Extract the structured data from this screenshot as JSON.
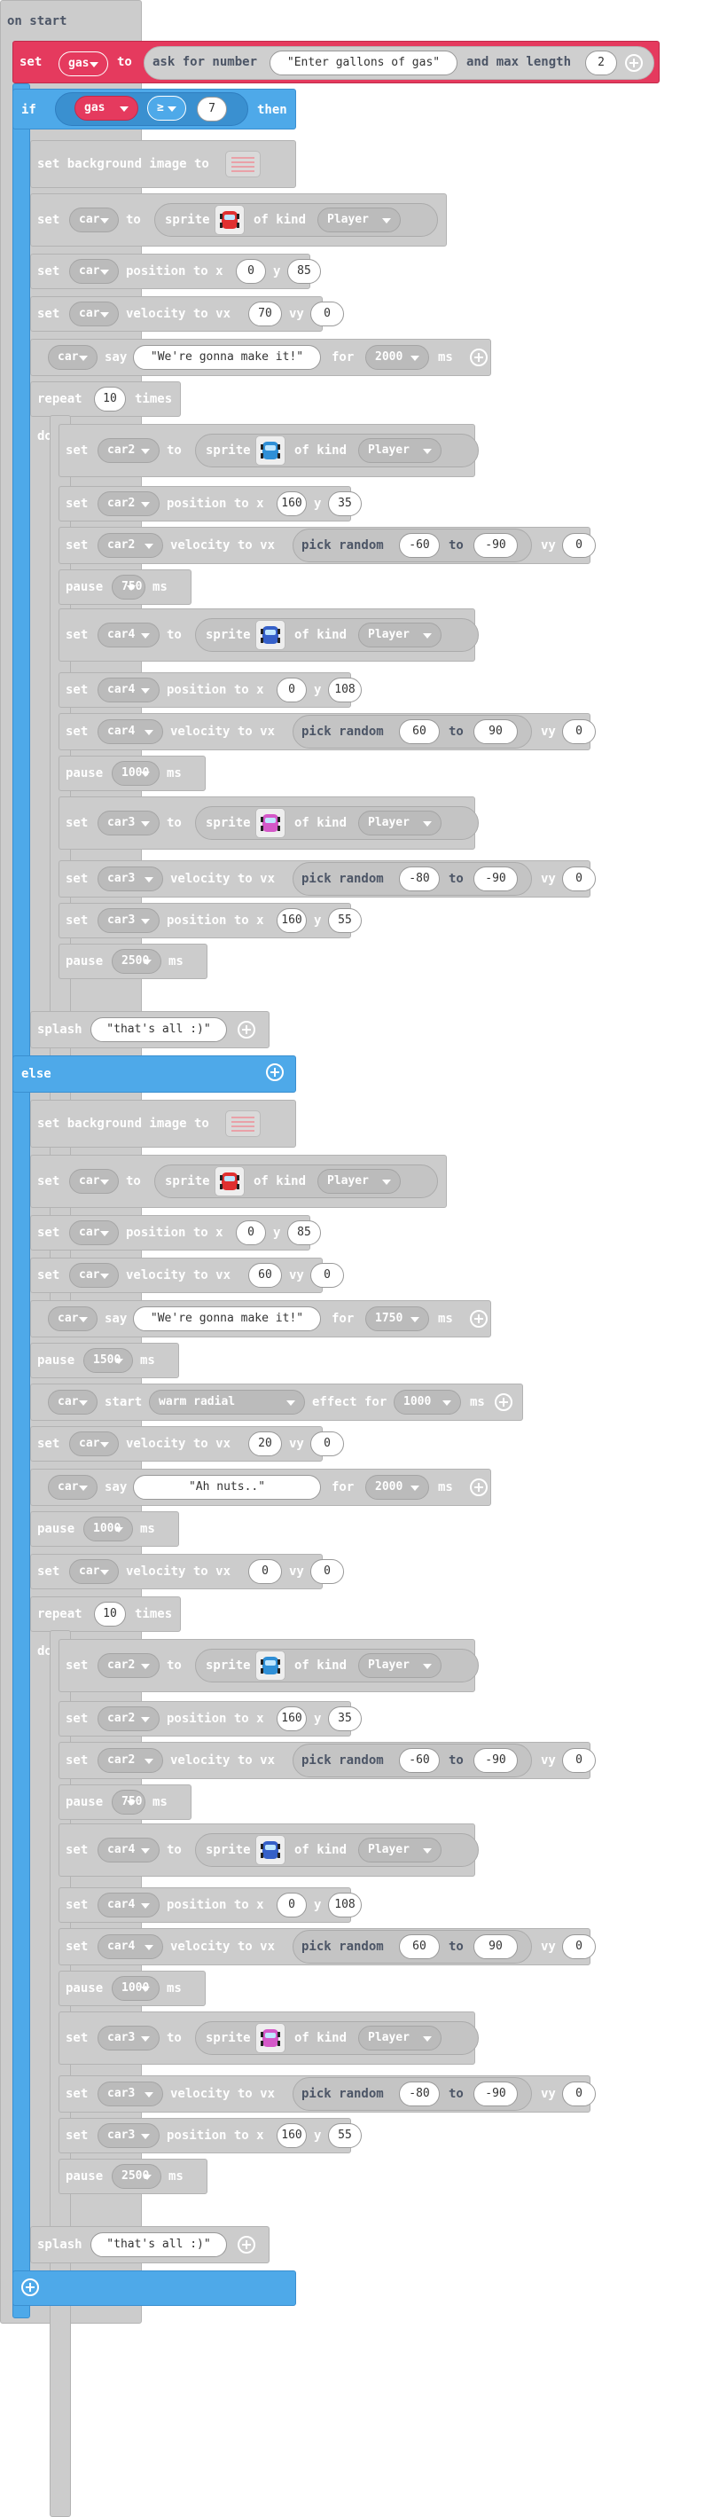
{
  "event": {
    "label": "on start"
  },
  "gas_row": {
    "set": "set",
    "var": "gas",
    "to": "to",
    "ask": "ask for number",
    "prompt": "\"Enter gallons of gas\"",
    "and_max": "and max length",
    "max": "2"
  },
  "if_row": {
    "if": "if",
    "var": "gas",
    "op": "≥",
    "value": "7",
    "then": "then"
  },
  "else_label": "else",
  "rows_if": [
    {
      "t": "bg"
    },
    {
      "t": "sprite",
      "v": "car",
      "k": "Player",
      "c": "red"
    },
    {
      "t": "pos",
      "v": "car",
      "x": "0",
      "y": "85"
    },
    {
      "t": "vel",
      "v": "car",
      "vx": "70",
      "vy": "0"
    },
    {
      "t": "say",
      "v": "car",
      "text": "\"We're gonna make it!\"",
      "ms": "2000"
    },
    {
      "t": "repeat",
      "n": "10"
    }
  ],
  "labels": {
    "set": "set",
    "to": "to",
    "sprite": "sprite",
    "of_kind": "of kind",
    "position_to_x": "position to x",
    "y": "y",
    "velocity_to_vx": "velocity to vx",
    "vy": "vy",
    "say": "say",
    "for": "for",
    "ms": "ms",
    "repeat": "repeat",
    "times": "times",
    "do": "do",
    "pause": "pause",
    "pick_random": "pick random",
    "to_word": "to",
    "splash": "splash",
    "start": "start",
    "effect_for": "effect for",
    "set_background": "set background image to"
  },
  "loop": {
    "car2": {
      "var": "car2",
      "x": "160",
      "y": "35",
      "r1": "-60",
      "r2": "-90",
      "vy": "0",
      "pause": "750",
      "kind": "Player"
    },
    "car4": {
      "var": "car4",
      "x": "0",
      "y": "108",
      "r1": "60",
      "r2": "90",
      "vy": "0",
      "pause": "1000",
      "kind": "Player"
    },
    "car3": {
      "var": "car3",
      "x": "160",
      "y": "55",
      "r1": "-80",
      "r2": "-90",
      "vy": "0",
      "pause": "2500",
      "kind": "Player"
    }
  },
  "splash_text": "\"that's all :)\"",
  "else_values": {
    "car_x": "0",
    "car_y": "85",
    "vx1": "60",
    "vy1": "0",
    "say1": "\"We're gonna make it!\"",
    "say1_ms": "1750",
    "pause1": "1500",
    "effect": "warm radial",
    "effect_ms": "1000",
    "vx2": "20",
    "vy2": "0",
    "say2": "\"Ah nuts..\"",
    "say2_ms": "2000",
    "pause2": "1000",
    "vx3": "0",
    "vy3": "0",
    "repeat": "10"
  },
  "car": "car",
  "kind": "Player",
  "colors": {
    "event": "#cccccc",
    "variables": "#e53a5e",
    "logic": "#4ea9e9",
    "sprites": "#cccccc"
  }
}
